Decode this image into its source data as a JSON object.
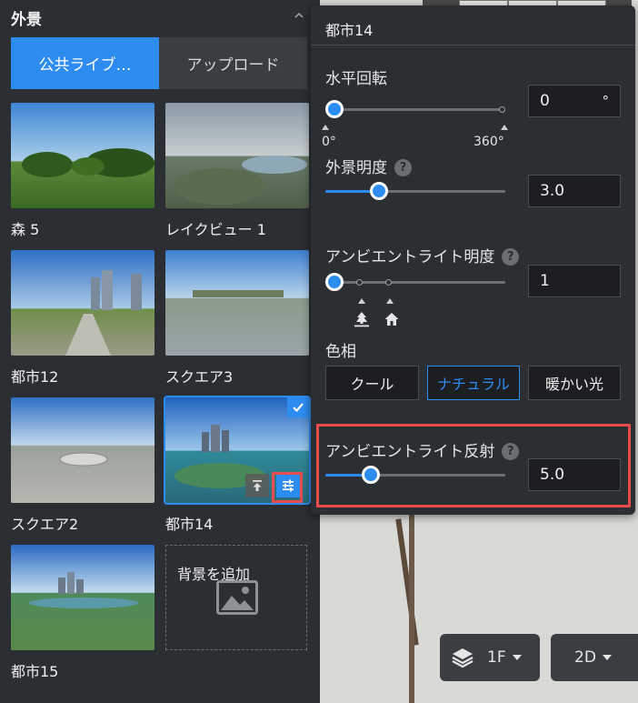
{
  "library": {
    "title": "外景",
    "tabs": [
      {
        "label": "公共ライブ…",
        "active": true
      },
      {
        "label": "アップロード",
        "active": false
      }
    ],
    "cards": [
      {
        "label": "森 5"
      },
      {
        "label": "レイクビュー 1"
      },
      {
        "label": "都市12"
      },
      {
        "label": "スクエア3"
      },
      {
        "label": "スクエア2"
      },
      {
        "label": "都市14",
        "selected": true
      },
      {
        "label": "都市15"
      }
    ],
    "add_background_label": "背景を追加"
  },
  "popover": {
    "title": "都市14",
    "rotation": {
      "label": "水平回転",
      "value": "0",
      "unit": "°",
      "slider_fraction": 0.0,
      "min_label": "0°",
      "max_label": "360°"
    },
    "brightness": {
      "label": "外景明度",
      "value": "3.0",
      "slider_fraction": 0.3
    },
    "ambient_brightness": {
      "label": "アンビエントライト明度",
      "value": "1",
      "slider_fraction": 0.0
    },
    "hue": {
      "label": "色相",
      "options": [
        "クール",
        "ナチュラル",
        "暖かい光"
      ],
      "selected": "ナチュラル"
    },
    "ambient_reflection": {
      "label": "アンビエントライト反射",
      "value": "5.0",
      "slider_fraction": 0.25
    }
  },
  "toolbar": {
    "floor": "1F",
    "view": "2D"
  },
  "colors": {
    "accent": "#2d8cf0",
    "highlight": "#e84c4c",
    "panel": "#2b2e33"
  }
}
